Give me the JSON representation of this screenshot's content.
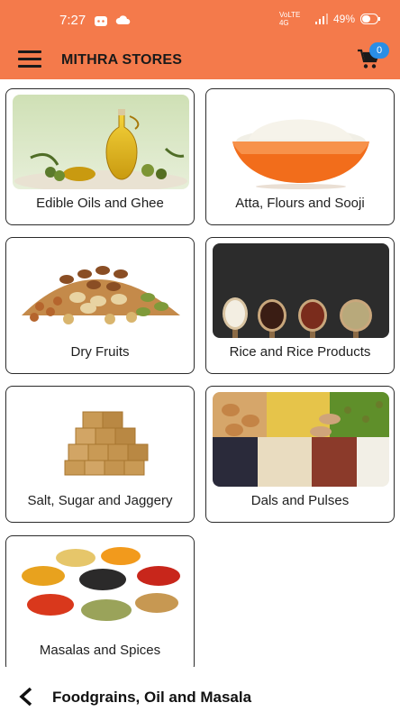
{
  "status_bar": {
    "time": "7:27",
    "network_label": "VoLTE 4G",
    "battery_percent": "49%"
  },
  "header": {
    "title": "MITHRA STORES",
    "cart_count": "0"
  },
  "categories": [
    {
      "label": "Edible Oils and Ghee",
      "icon": "oil-bottle-image"
    },
    {
      "label": "Atta, Flours and Sooji",
      "icon": "flour-bowl-image"
    },
    {
      "label": "Dry Fruits",
      "icon": "dry-fruits-image"
    },
    {
      "label": "Rice and Rice Products",
      "icon": "rice-spoons-image"
    },
    {
      "label": "Salt, Sugar and Jaggery",
      "icon": "jaggery-image"
    },
    {
      "label": "Dals and Pulses",
      "icon": "pulses-image"
    },
    {
      "label": "Masalas and Spices",
      "icon": "spices-image"
    }
  ],
  "bottom_bar": {
    "title": "Foodgrains, Oil and Masala"
  },
  "colors": {
    "header_bg": "#f47a4b",
    "badge_bg": "#2a8ee6"
  }
}
